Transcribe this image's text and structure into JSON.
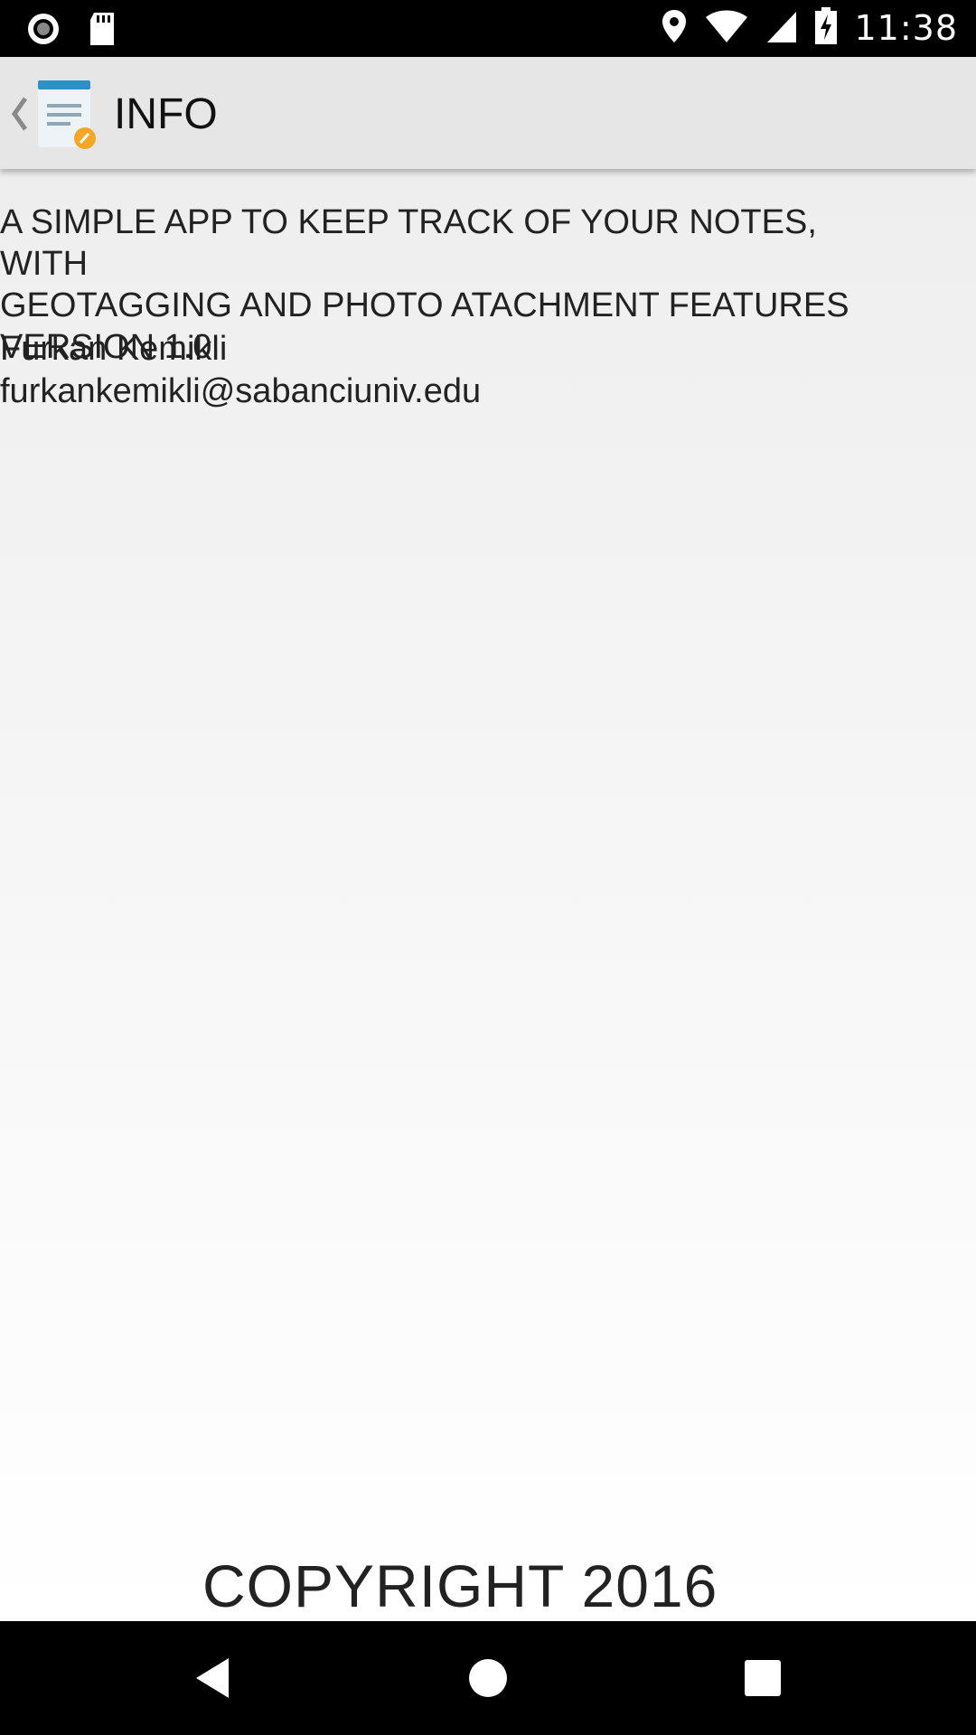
{
  "status_bar": {
    "time": "11:38",
    "icons": [
      "record-icon",
      "sd-card-icon",
      "location-icon",
      "wifi-icon",
      "signal-icon",
      "battery-charging-icon"
    ]
  },
  "action_bar": {
    "title": "INFO",
    "app_icon": "notes-app-icon",
    "back_icon": "back-chevron-icon"
  },
  "info": {
    "description": "A SIMPLE APP TO KEEP TRACK OF YOUR NOTES, WITH\nGEOTAGGING AND PHOTO ATACHMENT FEATURES\n VERSION 1.0",
    "author": "Furkan Kemikli",
    "email": "furkankemikli@sabanciuniv.edu",
    "copyright": "COPYRIGHT 2016"
  },
  "nav_bar": {
    "icons": [
      "back-icon",
      "home-icon",
      "recents-icon"
    ]
  },
  "colors": {
    "action_bar_bg": "#e6e6e6",
    "app_icon_blue": "#2f8fc8",
    "app_icon_badge": "#f5a623"
  }
}
